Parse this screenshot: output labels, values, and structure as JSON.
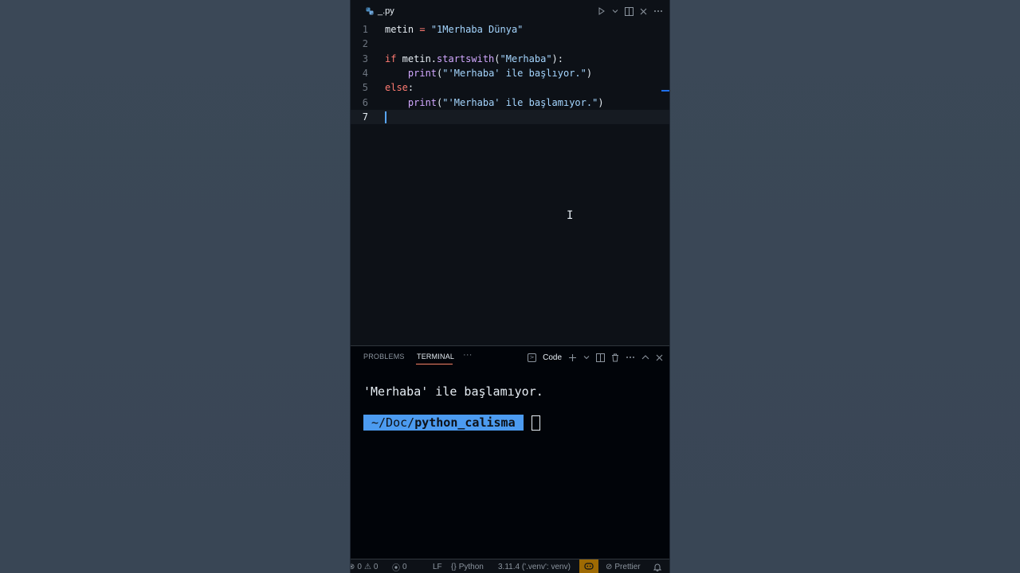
{
  "editor": {
    "tab": {
      "filename": "_.py",
      "icon": "python-icon"
    },
    "lines": [
      {
        "num": "1"
      },
      {
        "num": "2"
      },
      {
        "num": "3"
      },
      {
        "num": "4"
      },
      {
        "num": "5"
      },
      {
        "num": "6"
      },
      {
        "num": "7"
      }
    ],
    "code": {
      "l1_var": "metin",
      "l1_eq": " = ",
      "l1_str": "\"1Merhaba Dünya\"",
      "l3_if": "if",
      "l3_obj": " metin.",
      "l3_fn": "startswith",
      "l3_open": "(",
      "l3_str": "\"Merhaba\"",
      "l3_close": "):",
      "l4_indent": "    ",
      "l4_fn": "print",
      "l4_open": "(",
      "l4_str": "\"'Merhaba' ile başlıyor.\"",
      "l4_close": ")",
      "l5_else": "else",
      "l5_colon": ":",
      "l6_indent": "    ",
      "l6_fn": "print",
      "l6_open": "(",
      "l6_str": "\"'Merhaba' ile başlamıyor.\"",
      "l6_close": ")"
    },
    "active_line": 7
  },
  "panel": {
    "tabs": [
      "PROBLEMS",
      "TERMINAL"
    ],
    "active_tab": "TERMINAL",
    "more_label": "···",
    "terminal_name": "Code",
    "output": "'Merhaba' ile başlamıyor.",
    "prompt_prefix": "~/Doc/",
    "prompt_dir": "python_calisma"
  },
  "statusbar": {
    "errors": "0",
    "warnings": "0",
    "ports": "0",
    "eol": "LF",
    "language": "Python",
    "interpreter": "3.11.4 ('.venv': venv)",
    "formatter": "Prettier"
  },
  "colors": {
    "editor_bg": "#0d1117",
    "panel_bg": "#010409",
    "accent": "#4c9bf0",
    "keyword": "#ff7b72",
    "string": "#a5d6ff",
    "function": "#d2a8ff",
    "copilot": "#9e6a03"
  }
}
